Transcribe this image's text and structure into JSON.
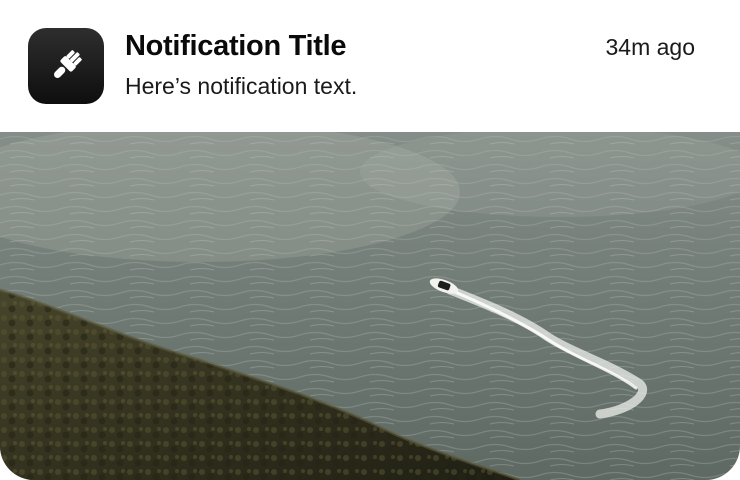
{
  "notification": {
    "app_icon": "paintbrush-icon",
    "title": "Notification Title",
    "text": "Here’s notification text.",
    "time": "34m ago"
  },
  "media": {
    "subject": "aerial-sea-boat-cliff-photo"
  },
  "colors": {
    "icon_background": "#1a1a1a",
    "sea": "#6f7872",
    "hill": "#3b3a23",
    "text": "#0a0a0a"
  }
}
